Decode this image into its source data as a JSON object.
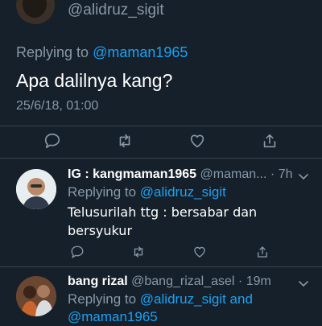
{
  "top": {
    "handle": "@alidruz_sigit"
  },
  "main_tweet": {
    "replying_prefix": "Replying to",
    "replying_handle": "@maman1965",
    "text": "Apa dalilnya kang?",
    "timestamp": "25/6/18, 01:00",
    "actions": [
      "reply-icon",
      "retweet-icon",
      "like-icon",
      "share-icon"
    ]
  },
  "replies": [
    {
      "name": "IG : kangmaman1965",
      "handle": "@maman...",
      "dot": " · ",
      "time": "7h",
      "replying_prefix": "Replying to",
      "replying_handle": "@alidruz_sigit",
      "text": "Telusurilah ttg : bersabar dan bersyukur"
    },
    {
      "name": "bang rizal",
      "handle": "@bang_rizal_asel",
      "dot": " · ",
      "time": "19m",
      "replying_prefix": "Replying to",
      "replying_handle": "@alidruz_sigit and",
      "replying_handle_2": "@maman1965"
    }
  ],
  "colors": {
    "background": "#15202b",
    "link": "#1da1f2",
    "muted": "#8899a6",
    "divider": "#38444d"
  }
}
